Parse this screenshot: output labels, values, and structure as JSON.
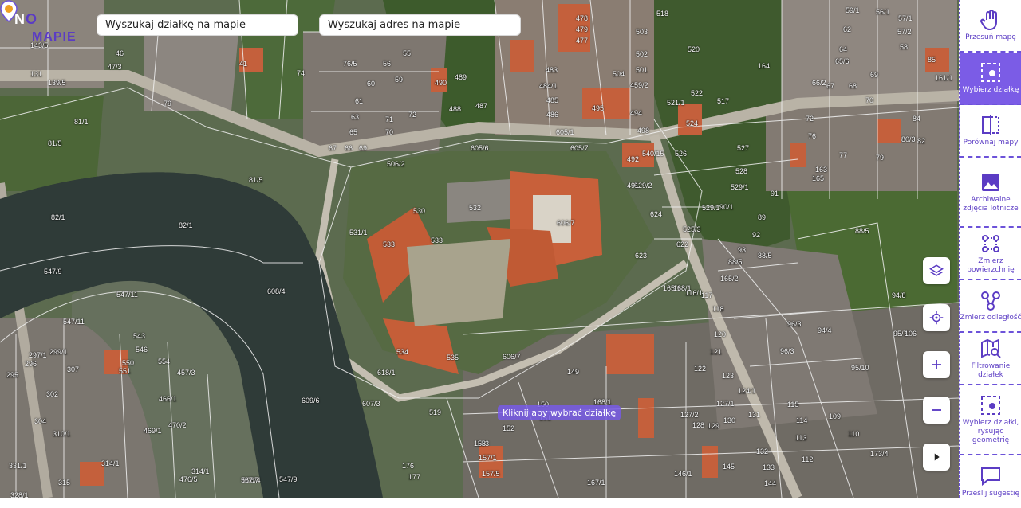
{
  "logo": {
    "part1": "N",
    "part2": "O",
    "part3": "MAPIE"
  },
  "search": {
    "parcel_placeholder": "Wyszukaj działkę na mapie",
    "address_placeholder": "Wyszukaj adres na mapie"
  },
  "map": {
    "tooltip": "Kliknij aby wybrać działkę",
    "parcels": [
      "131",
      "143/5",
      "139/5",
      "81/1",
      "81/5",
      "47/3",
      "46",
      "41",
      "74",
      "79",
      "76/5",
      "56",
      "55",
      "59",
      "61",
      "63",
      "65",
      "66",
      "69",
      "70",
      "71",
      "72",
      "67",
      "60",
      "490",
      "489",
      "488",
      "487",
      "479",
      "478",
      "477",
      "483",
      "484/1",
      "485",
      "486",
      "495",
      "494",
      "459/2",
      "502",
      "501",
      "503",
      "504",
      "498",
      "605/1",
      "605/6",
      "605/7",
      "506/2",
      "529/2",
      "529/1",
      "81/5",
      "82/1",
      "82/1",
      "547/9",
      "547/11",
      "547/11",
      "608/4",
      "608/4",
      "609/6",
      "531/1",
      "530",
      "532",
      "533",
      "533",
      "606/7",
      "623",
      "624",
      "622",
      "525/3",
      "491",
      "492",
      "540/15",
      "517",
      "518",
      "520",
      "521/1",
      "522",
      "524",
      "526",
      "527",
      "528",
      "529/1",
      "90/1",
      "89",
      "91",
      "92",
      "93",
      "88/5",
      "88/5",
      "88/5",
      "96/3",
      "94/8",
      "94/4",
      "96/3",
      "95/7",
      "95/10",
      "106",
      "109",
      "110",
      "112",
      "113",
      "114",
      "115",
      "165/2",
      "165/1",
      "168/1",
      "116/1",
      "117",
      "118",
      "120",
      "121",
      "122",
      "123",
      "124/1",
      "127/1",
      "127/2",
      "128",
      "129",
      "130",
      "131",
      "132",
      "133",
      "144",
      "145",
      "146/1",
      "149",
      "150",
      "151",
      "152",
      "153",
      "157/1",
      "157/5",
      "158",
      "167/1",
      "168/1",
      "173/4",
      "176",
      "177",
      "543",
      "546",
      "551",
      "550",
      "554",
      "457/3",
      "466/1",
      "469/1",
      "470/2",
      "476/5",
      "314/1",
      "314/1",
      "315",
      "331/1",
      "328/1",
      "297/1",
      "295",
      "299/1",
      "296",
      "302",
      "304",
      "310/1",
      "307",
      "547/9",
      "567/7",
      "606/7",
      "607/3",
      "618/1",
      "519",
      "534",
      "535",
      "56/1",
      "57/2",
      "57/1",
      "58",
      "59/1",
      "62",
      "64",
      "65/6",
      "67",
      "68",
      "66/2",
      "69",
      "70",
      "72",
      "76",
      "77",
      "79",
      "80/3",
      "82",
      "84",
      "85",
      "164",
      "161/1",
      "163",
      "165",
      "160/1",
      "74",
      "78/1"
    ]
  },
  "tools": [
    {
      "id": "pan",
      "label": "Przesuń mapę",
      "icon": "hand-icon",
      "active": false
    },
    {
      "id": "select",
      "label": "Wybierz działkę",
      "icon": "select-parcel-icon",
      "active": true
    },
    {
      "id": "compare",
      "label": "Porównaj mapy",
      "icon": "compare-icon",
      "active": false
    },
    {
      "id": "archive",
      "label": "Archiwalne zdjęcia lotnicze",
      "icon": "image-icon",
      "active": false
    },
    {
      "id": "area",
      "label": "Zmierz powierzchnię",
      "icon": "measure-area-icon",
      "active": false
    },
    {
      "id": "distance",
      "label": "Zmierz odległość",
      "icon": "measure-distance-icon",
      "active": false
    },
    {
      "id": "filter",
      "label": "Filtrowanie działek",
      "icon": "map-search-icon",
      "active": false
    },
    {
      "id": "draw",
      "label": "Wybierz działki, rysując geometrię",
      "icon": "draw-select-icon",
      "active": false
    },
    {
      "id": "feedback",
      "label": "Prześlij sugestię",
      "icon": "message-icon",
      "active": false
    }
  ],
  "colors": {
    "accent": "#7b5ce6",
    "border": "#6c52d9",
    "roof": "#c8603a",
    "river": "#2f3b38"
  }
}
